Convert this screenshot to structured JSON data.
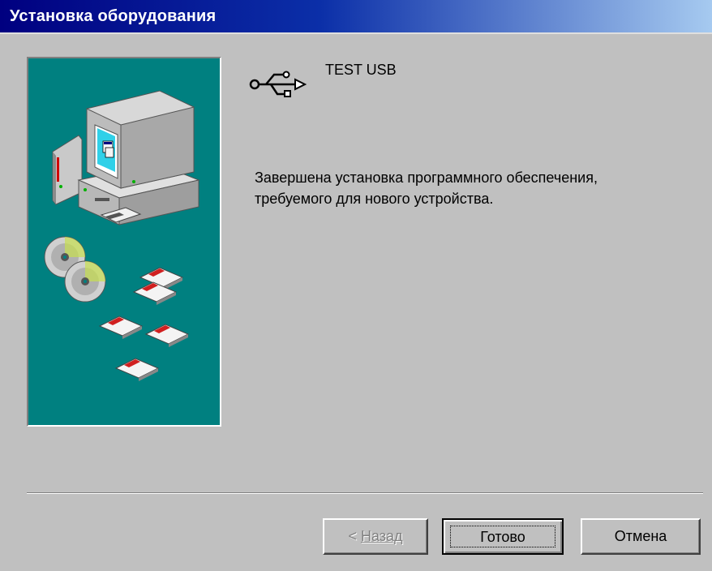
{
  "window": {
    "title": "Установка оборудования"
  },
  "device": {
    "name": "TEST USB",
    "icon": "usb-icon"
  },
  "message": {
    "line1": "Завершена установка программного обеспечения,",
    "line2": "требуемого для нового устройства."
  },
  "buttons": {
    "back_prefix": "< ",
    "back_label": "Назад",
    "finish_label": "Готово",
    "cancel_label": "Отмена"
  },
  "colors": {
    "title_start": "#000080",
    "title_end": "#a6caf0",
    "art_background": "#008080",
    "window_background": "#c0c0c0"
  }
}
